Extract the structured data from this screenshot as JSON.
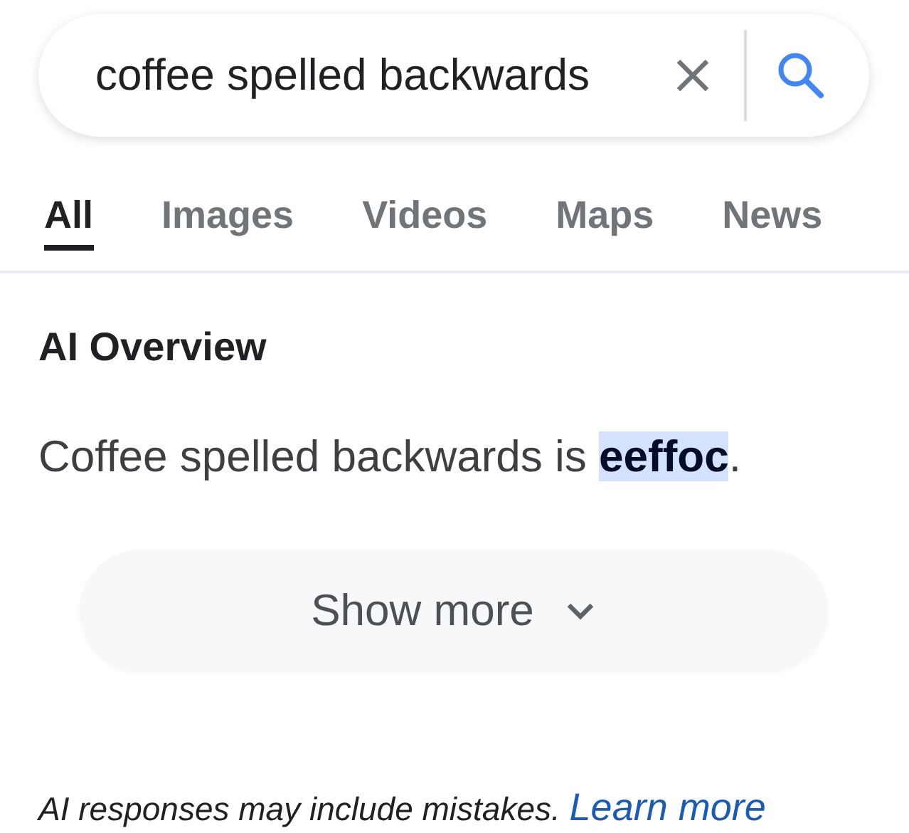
{
  "search": {
    "value": "coffee spelled backwards"
  },
  "tabs": [
    {
      "label": "All",
      "selected": true
    },
    {
      "label": "Images",
      "selected": false
    },
    {
      "label": "Videos",
      "selected": false
    },
    {
      "label": "Maps",
      "selected": false
    },
    {
      "label": "News",
      "selected": false
    }
  ],
  "overview": {
    "heading": "AI Overview",
    "answer": "Coffee spelled backwards is **eeffoc**.",
    "show_more": "Show more"
  },
  "disclaimer": {
    "text": "AI responses may include mistakes.",
    "link": "Learn more"
  }
}
